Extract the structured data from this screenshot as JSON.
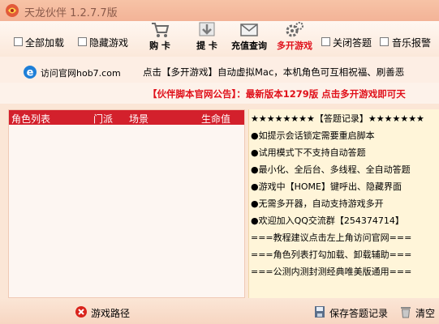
{
  "window": {
    "title": "天龙伙伴 1.2.7.7版"
  },
  "options": {
    "all_load": "全部加载",
    "hide_game": "隐藏游戏",
    "close_answer": "关闭答题",
    "music_alert": "音乐报警"
  },
  "toolbar": {
    "buy_card": "购 卡",
    "redeem_card": "提 卡",
    "recharge_query": "充值查询",
    "multi_game": "多开游戏"
  },
  "colors": {
    "accent_red": "#d3202c",
    "notice_red": "#e0101a",
    "log_bg": "#fff5d9",
    "window_bg": "#fbe6d6"
  },
  "info": {
    "visit_site": "访问官网hob7.com",
    "tip": "点击【多开游戏】自动虚拟Mac，本机角色可互相祝福、刷善恶"
  },
  "notice": {
    "text": "【伙伴脚本官网公告】：最新版本1279版  点击多开游戏即可天"
  },
  "char_list": {
    "columns": [
      "角色列表",
      "门派",
      "场景",
      "生命值"
    ]
  },
  "answer_log": {
    "lines": [
      "★★★★★★★★【答题记录】★★★★★★★",
      "●如提示会话锁定需要重启脚本",
      "●试用模式下不支持自动答题",
      "●最小化、全后台、多线程、全自动答题",
      "●游戏中【HOME】键呼出、隐藏界面",
      "●无需多开器，自动支持游戏多开",
      "●欢迎加入QQ交流群【254374714】",
      "===教程建议点击左上角访问官网===",
      "===角色列表打勾加载、卸载辅助===",
      "===公测内测封测经典唯美版通用==="
    ]
  },
  "bottom": {
    "game_path": "游戏路径",
    "save_log": "保存答题记录",
    "clear": "清空"
  }
}
